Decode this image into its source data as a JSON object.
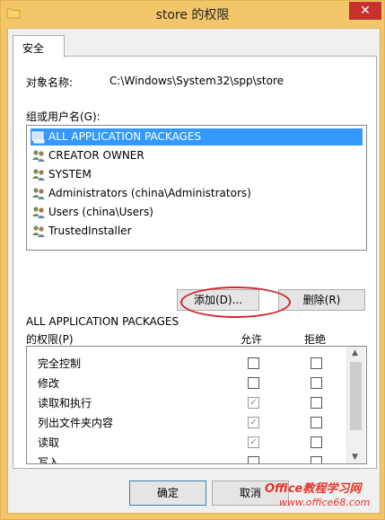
{
  "window": {
    "title": "store 的权限",
    "close_glyph": "✕"
  },
  "tabs": [
    {
      "label": "安全"
    }
  ],
  "object": {
    "label": "对象名称:",
    "value": "C:\\Windows\\System32\\spp\\store"
  },
  "groups": {
    "label": "组或用户名(G):",
    "items": [
      {
        "label": "ALL APPLICATION PACKAGES",
        "icon": "package-icon",
        "selected": true
      },
      {
        "label": "CREATOR OWNER",
        "icon": "users-icon",
        "selected": false
      },
      {
        "label": "SYSTEM",
        "icon": "users-icon",
        "selected": false
      },
      {
        "label": "Administrators (china\\Administrators)",
        "icon": "users-icon",
        "selected": false
      },
      {
        "label": "Users (china\\Users)",
        "icon": "users-icon",
        "selected": false
      },
      {
        "label": "TrustedInstaller",
        "icon": "users-icon",
        "selected": false
      }
    ]
  },
  "buttons": {
    "add": "添加(D)...",
    "remove": "删除(R)",
    "ok": "确定",
    "cancel": "取消"
  },
  "permissions": {
    "heading_line1": "ALL APPLICATION PACKAGES",
    "heading_line2": "的权限(P)",
    "allow_label": "允许",
    "deny_label": "拒绝",
    "rows": [
      {
        "name": "完全控制",
        "allow": false,
        "deny": false
      },
      {
        "name": "修改",
        "allow": false,
        "deny": false
      },
      {
        "name": "读取和执行",
        "allow": true,
        "deny": false
      },
      {
        "name": "列出文件夹内容",
        "allow": true,
        "deny": false
      },
      {
        "name": "读取",
        "allow": true,
        "deny": false
      },
      {
        "name": "写入",
        "allow": false,
        "deny": false
      }
    ]
  },
  "watermark": {
    "line1": "Office教程学习网",
    "line2": "www.office68.com"
  },
  "colors": {
    "selection": "#3399ff",
    "frame": "#f3c66a",
    "close": "#c7302c",
    "highlight": "#d3262c"
  }
}
